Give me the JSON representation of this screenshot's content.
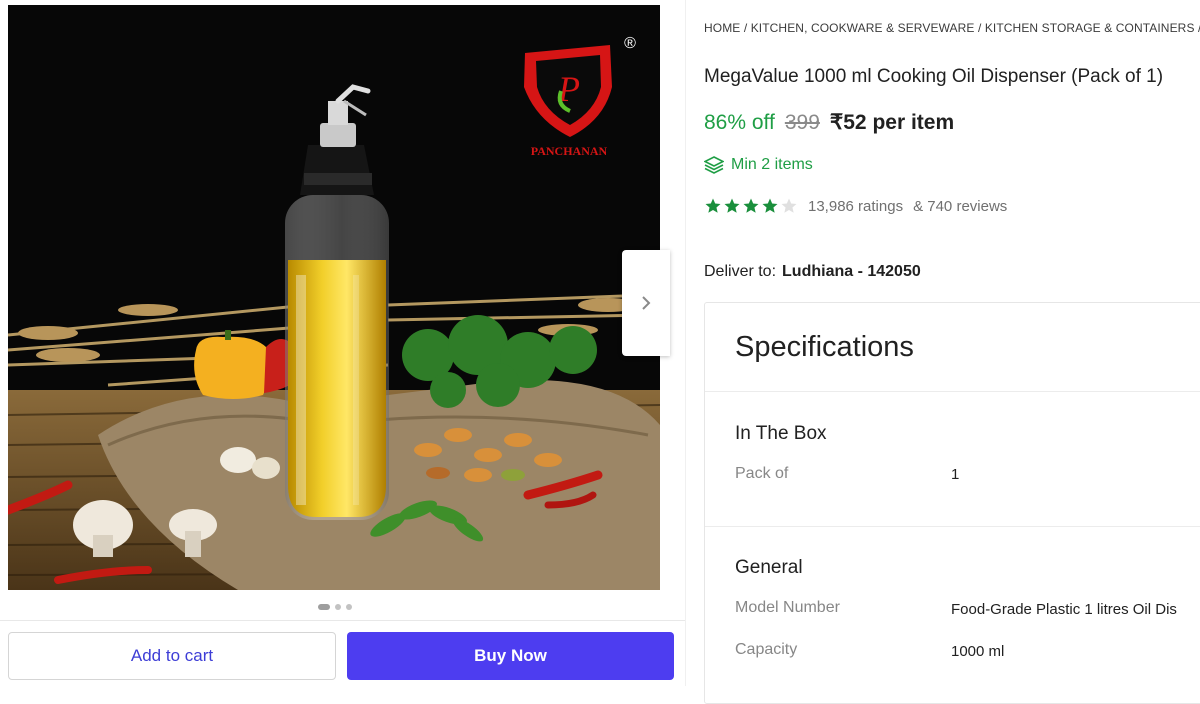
{
  "product_image": {
    "brand_logo_text": "PANCHANAN",
    "brand_logo_letter": "P",
    "registered_mark": "®"
  },
  "gallery": {
    "dots": 3,
    "active_dot": 0
  },
  "actions": {
    "add_to_cart": "Add to cart",
    "buy_now": "Buy Now"
  },
  "breadcrumb": "HOME / KITCHEN, COOKWARE & SERVEWARE / KITCHEN STORAGE & CONTAINERS / C",
  "product": {
    "title": "MegaValue 1000 ml Cooking Oil Dispenser (Pack of 1)",
    "discount": "86% off",
    "mrp": "399",
    "price": "₹52 per item",
    "min_items": "Min 2 items",
    "rating_stars": 4,
    "rating_max": 5,
    "ratings": "13,986 ratings",
    "reviews": "& 740 reviews"
  },
  "delivery": {
    "label": "Deliver to:",
    "location": "Ludhiana - 142050"
  },
  "specifications": {
    "title": "Specifications",
    "in_the_box": {
      "heading": "In The Box",
      "rows": [
        {
          "key": "Pack of",
          "value": "1"
        }
      ]
    },
    "general": {
      "heading": "General",
      "rows": [
        {
          "key": "Model Number",
          "value": "Food-Grade Plastic 1 litres Oil Dis"
        },
        {
          "key": "Capacity",
          "value": "1000 ml"
        }
      ]
    }
  },
  "colors": {
    "accent": "#4d3df0",
    "discount_green": "#1f9e45",
    "star_green": "#1a8f3c"
  }
}
